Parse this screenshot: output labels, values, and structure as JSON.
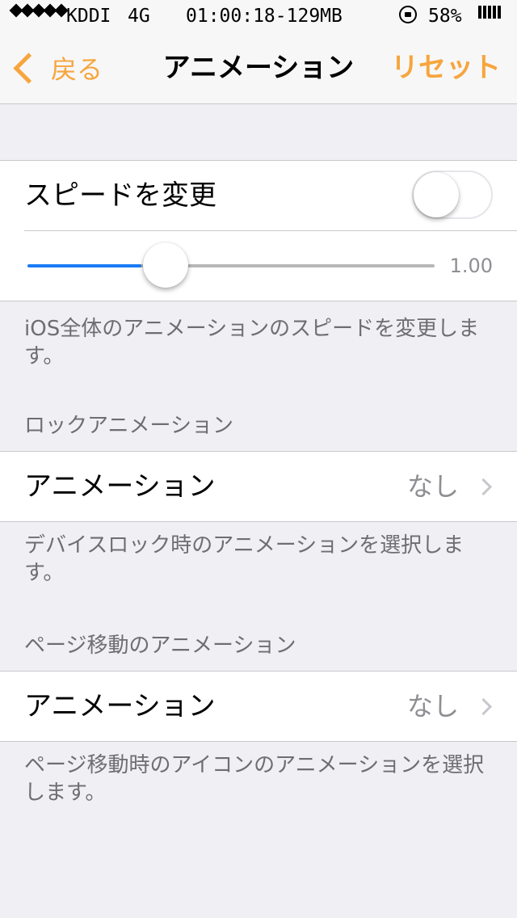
{
  "status_bar": {
    "carrier": "KDDI",
    "network": "4G",
    "time": "01:00:18-129MB",
    "battery_percent": "58%",
    "icons": [
      "signal-dots-icon",
      "rotation-lock-icon",
      "battery-bars-icon"
    ]
  },
  "nav": {
    "back_label": "戻る",
    "title": "アニメーション",
    "reset_label": "リセット",
    "accent_color": "#f7a53d"
  },
  "speed_group": {
    "toggle_label": "スピードを変更",
    "toggle_on": false,
    "slider_value_label": "1.00",
    "slider_fraction": 0.28,
    "footer": "iOS全体のアニメーションのスピードを変更します。"
  },
  "lock_group": {
    "header": "ロックアニメーション",
    "row_label": "アニメーション",
    "row_value": "なし",
    "footer": "デバイスロック時のアニメーションを選択します。"
  },
  "page_group": {
    "header": "ページ移動のアニメーション",
    "row_label": "アニメーション",
    "row_value": "なし",
    "footer": "ページ移動時のアイコンのアニメーションを選択します。"
  }
}
